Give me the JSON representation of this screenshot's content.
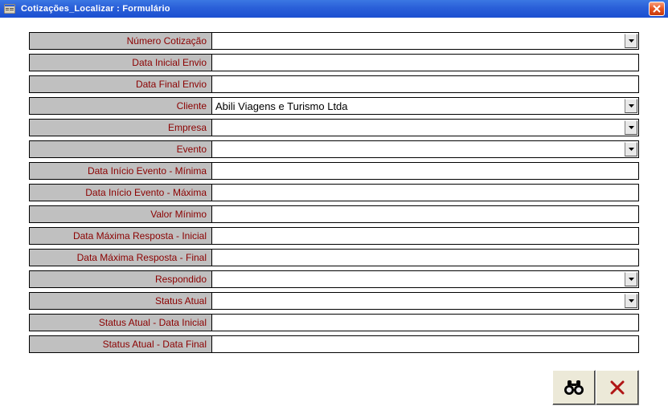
{
  "window": {
    "title": "Cotizações_Localizar : Formulário"
  },
  "fields": {
    "numero_cotacao": {
      "label": "Número Cotização",
      "value": "",
      "combo": true
    },
    "data_inicial_envio": {
      "label": "Data Inicial Envio",
      "value": "",
      "combo": false
    },
    "data_final_envio": {
      "label": "Data Final Envio",
      "value": "",
      "combo": false
    },
    "cliente": {
      "label": "Cliente",
      "value": "Abili Viagens e Turismo Ltda",
      "combo": true
    },
    "empresa": {
      "label": "Empresa",
      "value": "",
      "combo": true
    },
    "evento": {
      "label": "Evento",
      "value": "",
      "combo": true
    },
    "data_inicio_min": {
      "label": "Data Início Evento - Mínima",
      "value": "",
      "combo": false
    },
    "data_inicio_max": {
      "label": "Data Início Evento - Máxima",
      "value": "",
      "combo": false
    },
    "valor_minimo": {
      "label": "Valor Mínimo",
      "value": "",
      "combo": false
    },
    "data_max_resp_inicial": {
      "label": "Data Máxima Resposta - Inicial",
      "value": "",
      "combo": false
    },
    "data_max_resp_final": {
      "label": "Data Máxima Resposta - Final",
      "value": "",
      "combo": false
    },
    "respondido": {
      "label": "Respondido",
      "value": "",
      "combo": true
    },
    "status_atual": {
      "label": "Status Atual",
      "value": "",
      "combo": true
    },
    "status_data_inicial": {
      "label": "Status Atual - Data Inicial",
      "value": "",
      "combo": false
    },
    "status_data_final": {
      "label": "Status Atual - Data Final",
      "value": "",
      "combo": false
    }
  },
  "buttons": {
    "search": "search",
    "cancel": "cancel"
  }
}
